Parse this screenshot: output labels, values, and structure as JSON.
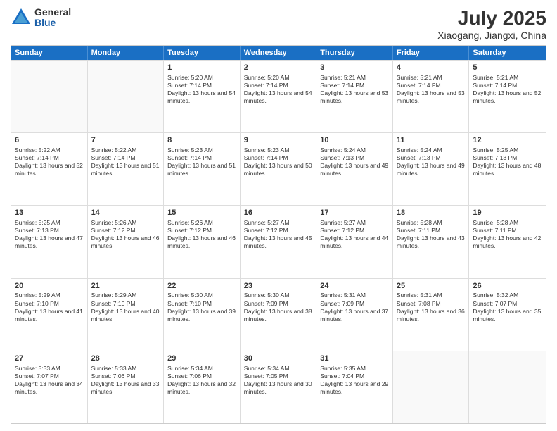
{
  "header": {
    "logo_general": "General",
    "logo_blue": "Blue",
    "title": "July 2025",
    "subtitle": "Xiaogang, Jiangxi, China"
  },
  "days_of_week": [
    "Sunday",
    "Monday",
    "Tuesday",
    "Wednesday",
    "Thursday",
    "Friday",
    "Saturday"
  ],
  "weeks": [
    [
      {
        "day": "",
        "sunrise": "",
        "sunset": "",
        "daylight": ""
      },
      {
        "day": "",
        "sunrise": "",
        "sunset": "",
        "daylight": ""
      },
      {
        "day": "1",
        "sunrise": "Sunrise: 5:20 AM",
        "sunset": "Sunset: 7:14 PM",
        "daylight": "Daylight: 13 hours and 54 minutes."
      },
      {
        "day": "2",
        "sunrise": "Sunrise: 5:20 AM",
        "sunset": "Sunset: 7:14 PM",
        "daylight": "Daylight: 13 hours and 54 minutes."
      },
      {
        "day": "3",
        "sunrise": "Sunrise: 5:21 AM",
        "sunset": "Sunset: 7:14 PM",
        "daylight": "Daylight: 13 hours and 53 minutes."
      },
      {
        "day": "4",
        "sunrise": "Sunrise: 5:21 AM",
        "sunset": "Sunset: 7:14 PM",
        "daylight": "Daylight: 13 hours and 53 minutes."
      },
      {
        "day": "5",
        "sunrise": "Sunrise: 5:21 AM",
        "sunset": "Sunset: 7:14 PM",
        "daylight": "Daylight: 13 hours and 52 minutes."
      }
    ],
    [
      {
        "day": "6",
        "sunrise": "Sunrise: 5:22 AM",
        "sunset": "Sunset: 7:14 PM",
        "daylight": "Daylight: 13 hours and 52 minutes."
      },
      {
        "day": "7",
        "sunrise": "Sunrise: 5:22 AM",
        "sunset": "Sunset: 7:14 PM",
        "daylight": "Daylight: 13 hours and 51 minutes."
      },
      {
        "day": "8",
        "sunrise": "Sunrise: 5:23 AM",
        "sunset": "Sunset: 7:14 PM",
        "daylight": "Daylight: 13 hours and 51 minutes."
      },
      {
        "day": "9",
        "sunrise": "Sunrise: 5:23 AM",
        "sunset": "Sunset: 7:14 PM",
        "daylight": "Daylight: 13 hours and 50 minutes."
      },
      {
        "day": "10",
        "sunrise": "Sunrise: 5:24 AM",
        "sunset": "Sunset: 7:13 PM",
        "daylight": "Daylight: 13 hours and 49 minutes."
      },
      {
        "day": "11",
        "sunrise": "Sunrise: 5:24 AM",
        "sunset": "Sunset: 7:13 PM",
        "daylight": "Daylight: 13 hours and 49 minutes."
      },
      {
        "day": "12",
        "sunrise": "Sunrise: 5:25 AM",
        "sunset": "Sunset: 7:13 PM",
        "daylight": "Daylight: 13 hours and 48 minutes."
      }
    ],
    [
      {
        "day": "13",
        "sunrise": "Sunrise: 5:25 AM",
        "sunset": "Sunset: 7:13 PM",
        "daylight": "Daylight: 13 hours and 47 minutes."
      },
      {
        "day": "14",
        "sunrise": "Sunrise: 5:26 AM",
        "sunset": "Sunset: 7:12 PM",
        "daylight": "Daylight: 13 hours and 46 minutes."
      },
      {
        "day": "15",
        "sunrise": "Sunrise: 5:26 AM",
        "sunset": "Sunset: 7:12 PM",
        "daylight": "Daylight: 13 hours and 46 minutes."
      },
      {
        "day": "16",
        "sunrise": "Sunrise: 5:27 AM",
        "sunset": "Sunset: 7:12 PM",
        "daylight": "Daylight: 13 hours and 45 minutes."
      },
      {
        "day": "17",
        "sunrise": "Sunrise: 5:27 AM",
        "sunset": "Sunset: 7:12 PM",
        "daylight": "Daylight: 13 hours and 44 minutes."
      },
      {
        "day": "18",
        "sunrise": "Sunrise: 5:28 AM",
        "sunset": "Sunset: 7:11 PM",
        "daylight": "Daylight: 13 hours and 43 minutes."
      },
      {
        "day": "19",
        "sunrise": "Sunrise: 5:28 AM",
        "sunset": "Sunset: 7:11 PM",
        "daylight": "Daylight: 13 hours and 42 minutes."
      }
    ],
    [
      {
        "day": "20",
        "sunrise": "Sunrise: 5:29 AM",
        "sunset": "Sunset: 7:10 PM",
        "daylight": "Daylight: 13 hours and 41 minutes."
      },
      {
        "day": "21",
        "sunrise": "Sunrise: 5:29 AM",
        "sunset": "Sunset: 7:10 PM",
        "daylight": "Daylight: 13 hours and 40 minutes."
      },
      {
        "day": "22",
        "sunrise": "Sunrise: 5:30 AM",
        "sunset": "Sunset: 7:10 PM",
        "daylight": "Daylight: 13 hours and 39 minutes."
      },
      {
        "day": "23",
        "sunrise": "Sunrise: 5:30 AM",
        "sunset": "Sunset: 7:09 PM",
        "daylight": "Daylight: 13 hours and 38 minutes."
      },
      {
        "day": "24",
        "sunrise": "Sunrise: 5:31 AM",
        "sunset": "Sunset: 7:09 PM",
        "daylight": "Daylight: 13 hours and 37 minutes."
      },
      {
        "day": "25",
        "sunrise": "Sunrise: 5:31 AM",
        "sunset": "Sunset: 7:08 PM",
        "daylight": "Daylight: 13 hours and 36 minutes."
      },
      {
        "day": "26",
        "sunrise": "Sunrise: 5:32 AM",
        "sunset": "Sunset: 7:07 PM",
        "daylight": "Daylight: 13 hours and 35 minutes."
      }
    ],
    [
      {
        "day": "27",
        "sunrise": "Sunrise: 5:33 AM",
        "sunset": "Sunset: 7:07 PM",
        "daylight": "Daylight: 13 hours and 34 minutes."
      },
      {
        "day": "28",
        "sunrise": "Sunrise: 5:33 AM",
        "sunset": "Sunset: 7:06 PM",
        "daylight": "Daylight: 13 hours and 33 minutes."
      },
      {
        "day": "29",
        "sunrise": "Sunrise: 5:34 AM",
        "sunset": "Sunset: 7:06 PM",
        "daylight": "Daylight: 13 hours and 32 minutes."
      },
      {
        "day": "30",
        "sunrise": "Sunrise: 5:34 AM",
        "sunset": "Sunset: 7:05 PM",
        "daylight": "Daylight: 13 hours and 30 minutes."
      },
      {
        "day": "31",
        "sunrise": "Sunrise: 5:35 AM",
        "sunset": "Sunset: 7:04 PM",
        "daylight": "Daylight: 13 hours and 29 minutes."
      },
      {
        "day": "",
        "sunrise": "",
        "sunset": "",
        "daylight": ""
      },
      {
        "day": "",
        "sunrise": "",
        "sunset": "",
        "daylight": ""
      }
    ]
  ]
}
